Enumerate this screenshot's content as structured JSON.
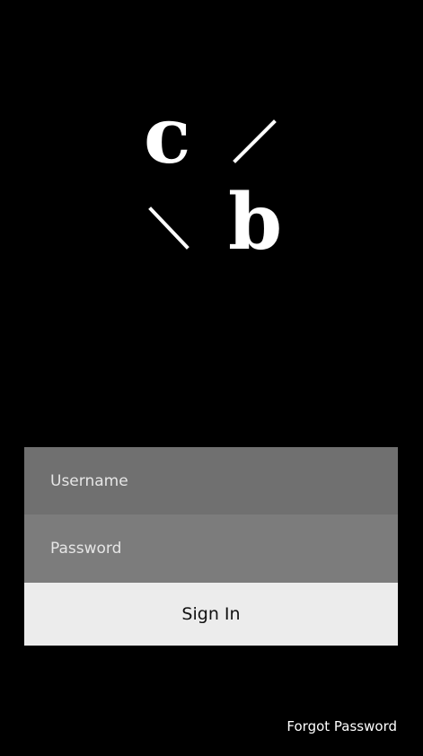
{
  "logo": {
    "top_letter": "c",
    "bottom_letter": "b",
    "icon": "cb-monogram-logo"
  },
  "login": {
    "username_placeholder": "Username",
    "password_placeholder": "Password",
    "signin_label": "Sign In",
    "forgot_label": "Forgot Password"
  },
  "colors": {
    "background": "#000000",
    "username_field": "#707070",
    "password_field": "#7c7c7c",
    "signin_button": "#ececec",
    "text_light": "#ffffff"
  }
}
